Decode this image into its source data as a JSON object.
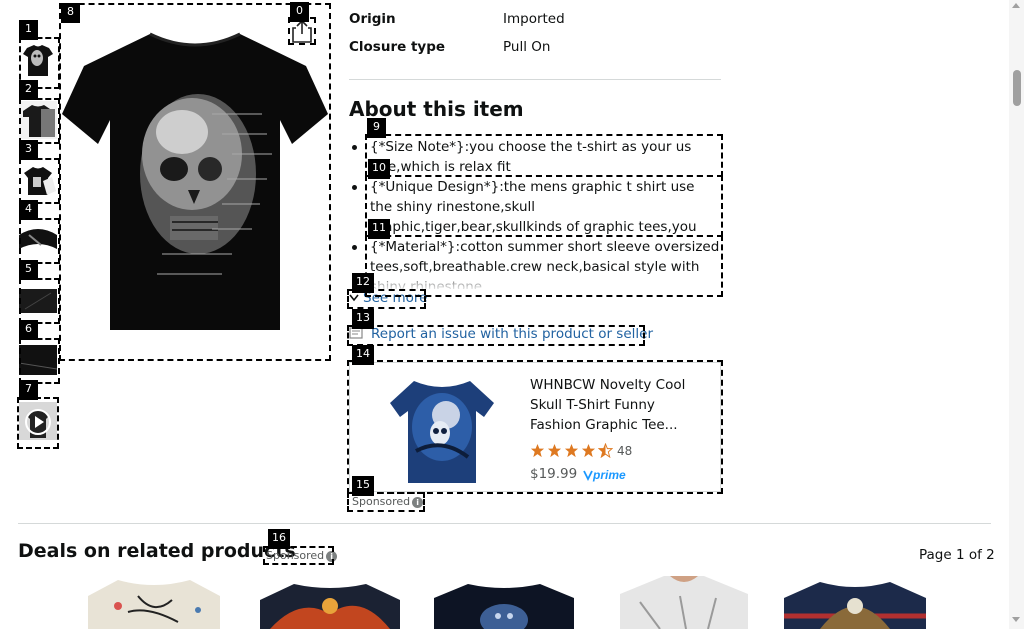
{
  "som_labels": [
    "0",
    "1",
    "2",
    "3",
    "4",
    "5",
    "6",
    "7",
    "8",
    "9",
    "10",
    "11",
    "12",
    "13",
    "14",
    "15",
    "16"
  ],
  "product": {
    "thumbnails": [
      {
        "name": "skull-rhinestone-tee-front"
      },
      {
        "name": "skull-tee-angle"
      },
      {
        "name": "skull-tee-worn"
      },
      {
        "name": "skull-tee-detail"
      },
      {
        "name": "skull-tee-folded"
      },
      {
        "name": "skull-tee-fabric"
      },
      {
        "name": "skull-tee-video",
        "is_video": true
      }
    ],
    "main_image": "black-tshirt-rhinestone-skull"
  },
  "specs": [
    {
      "label": "Origin",
      "value": "Imported"
    },
    {
      "label": "Closure type",
      "value": "Pull On"
    }
  ],
  "about": {
    "title": "About this item",
    "bullets": [
      "{*Size Note*}:you choose the t-shirt as your us size,which is relax fit",
      "{*Unique Design*}:the mens graphic t shirt use the shiny rinestone,skull graphic,tiger,bear,skullkinds of graphic tees,you should find them in our store.",
      "{*Material*}:cotton summer short sleeve oversized tees,soft,breathable.crew neck,basical style with shiny rhinestone"
    ],
    "see_more": "See more",
    "report_link": "Report an issue with this product or seller"
  },
  "ad": {
    "title": "WHNBCW Novelty Cool Skull T-Shirt Funny Fashion Graphic Tee...",
    "rating": 4.5,
    "rating_count": "48",
    "price": "$19.99",
    "prime_label": "prime",
    "sponsored": "Sponsored"
  },
  "deals": {
    "title": "Deals on related products",
    "sponsored": "Sponsored",
    "page_indicator": "Page 1 of 2"
  },
  "colors": {
    "link": "#2162a1",
    "star": "#de7921",
    "prime": "#1a98ff",
    "text": "#0f1111",
    "muted": "#565959",
    "divider": "#d5d9d9"
  }
}
